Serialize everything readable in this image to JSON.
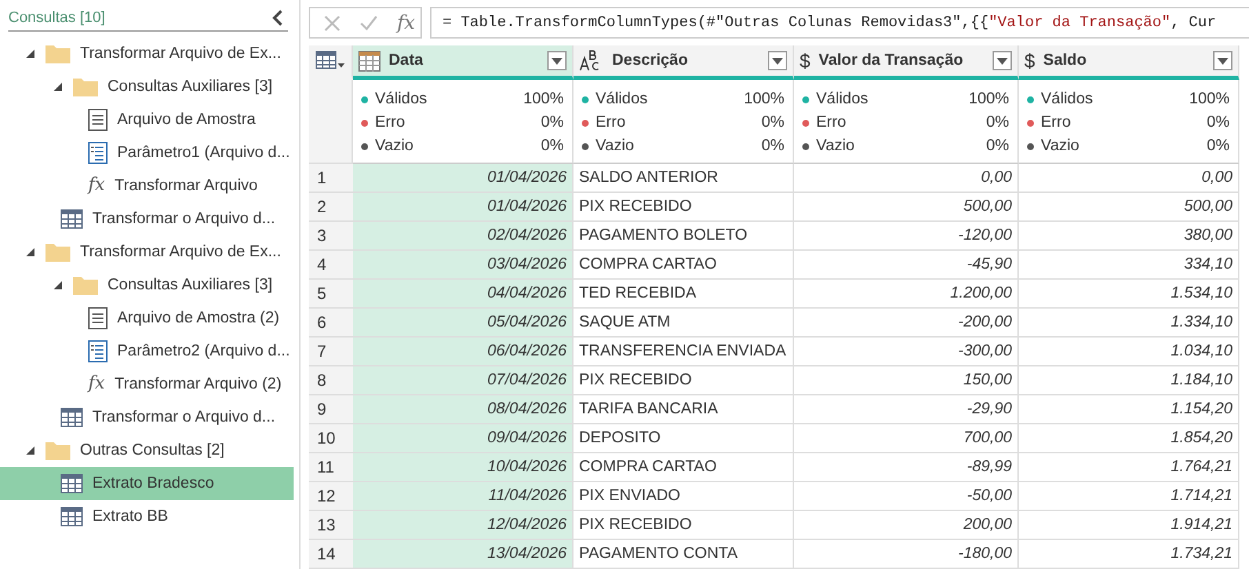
{
  "queries": {
    "title": "Consultas [10]",
    "items": [
      {
        "kind": "folder",
        "label": "Transformar Arquivo de Ex...",
        "expanded": true,
        "selected": false,
        "children": [
          {
            "kind": "folder",
            "label": "Consultas Auxiliares [3]",
            "expanded": true,
            "selected": false,
            "children": [
              {
                "kind": "query",
                "label": "Arquivo de Amostra",
                "selected": false
              },
              {
                "kind": "parameter",
                "label": "Parâmetro1 (Arquivo d...",
                "selected": false
              },
              {
                "kind": "function",
                "icon": "fx",
                "label": "Transformar Arquivo",
                "selected": false
              }
            ]
          },
          {
            "kind": "table",
            "label": "Transformar o Arquivo d...",
            "selected": false
          }
        ]
      },
      {
        "kind": "folder",
        "label": "Transformar Arquivo de Ex...",
        "expanded": true,
        "selected": false,
        "children": [
          {
            "kind": "folder",
            "label": "Consultas Auxiliares [3]",
            "expanded": true,
            "selected": false,
            "children": [
              {
                "kind": "query",
                "label": "Arquivo de Amostra (2)",
                "selected": false
              },
              {
                "kind": "parameter",
                "label": "Parâmetro2 (Arquivo d...",
                "selected": false
              },
              {
                "kind": "function",
                "icon": "fx",
                "label": "Transformar Arquivo (2)",
                "selected": false
              }
            ]
          },
          {
            "kind": "table",
            "label": "Transformar o Arquivo d...",
            "selected": false
          }
        ]
      },
      {
        "kind": "folder",
        "label": "Outras Consultas [2]",
        "expanded": true,
        "selected": false,
        "children": [
          {
            "kind": "table",
            "label": "Extrato Bradesco",
            "selected": true
          },
          {
            "kind": "table",
            "label": "Extrato BB",
            "selected": false
          }
        ]
      }
    ]
  },
  "formula_bar": {
    "fx": "fx",
    "segments": [
      {
        "kind": "code",
        "text": "= Table.TransformColumnTypes(#\"Outras Colunas Removidas3\",{{"
      },
      {
        "kind": "string",
        "text": "\"Valor da Transação\""
      },
      {
        "kind": "code",
        "text": ", Cur"
      }
    ]
  },
  "table": {
    "columns": [
      {
        "name": "Data",
        "kind": "date",
        "selected": true,
        "stats": [
          {
            "label": "Válidos",
            "value": "100%",
            "color": "#1fb3a3"
          },
          {
            "label": "Erro",
            "value": "0%",
            "color": "#e05a5a"
          },
          {
            "label": "Vazio",
            "value": "0%",
            "color": "#555555"
          }
        ]
      },
      {
        "name": "Descrição",
        "kind": "text",
        "selected": false,
        "stats": [
          {
            "label": "Válidos",
            "value": "100%",
            "color": "#1fb3a3"
          },
          {
            "label": "Erro",
            "value": "0%",
            "color": "#e05a5a"
          },
          {
            "label": "Vazio",
            "value": "0%",
            "color": "#555555"
          }
        ]
      },
      {
        "name": "Valor da Transação",
        "kind": "currency",
        "symbol": "$",
        "selected": false,
        "stats": [
          {
            "label": "Válidos",
            "value": "100%",
            "color": "#1fb3a3"
          },
          {
            "label": "Erro",
            "value": "0%",
            "color": "#e05a5a"
          },
          {
            "label": "Vazio",
            "value": "0%",
            "color": "#555555"
          }
        ]
      },
      {
        "name": "Saldo",
        "kind": "currency",
        "symbol": "$",
        "selected": false,
        "stats": [
          {
            "label": "Válidos",
            "value": "100%",
            "color": "#1fb3a3"
          },
          {
            "label": "Erro",
            "value": "0%",
            "color": "#e05a5a"
          },
          {
            "label": "Vazio",
            "value": "0%",
            "color": "#555555"
          }
        ]
      }
    ],
    "rows": [
      {
        "n": "1",
        "cells": [
          "01/04/2026",
          "SALDO ANTERIOR",
          "0,00",
          "0,00"
        ]
      },
      {
        "n": "2",
        "cells": [
          "01/04/2026",
          "PIX RECEBIDO",
          "500,00",
          "500,00"
        ]
      },
      {
        "n": "3",
        "cells": [
          "02/04/2026",
          "PAGAMENTO BOLETO",
          "-120,00",
          "380,00"
        ]
      },
      {
        "n": "4",
        "cells": [
          "03/04/2026",
          "COMPRA CARTAO",
          "-45,90",
          "334,10"
        ]
      },
      {
        "n": "5",
        "cells": [
          "04/04/2026",
          "TED RECEBIDA",
          "1.200,00",
          "1.534,10"
        ]
      },
      {
        "n": "6",
        "cells": [
          "05/04/2026",
          "SAQUE ATM",
          "-200,00",
          "1.334,10"
        ]
      },
      {
        "n": "7",
        "cells": [
          "06/04/2026",
          "TRANSFERENCIA ENVIADA",
          "-300,00",
          "1.034,10"
        ]
      },
      {
        "n": "8",
        "cells": [
          "07/04/2026",
          "PIX RECEBIDO",
          "150,00",
          "1.184,10"
        ]
      },
      {
        "n": "9",
        "cells": [
          "08/04/2026",
          "TARIFA BANCARIA",
          "-29,90",
          "1.154,20"
        ]
      },
      {
        "n": "10",
        "cells": [
          "09/04/2026",
          "DEPOSITO",
          "700,00",
          "1.854,20"
        ]
      },
      {
        "n": "11",
        "cells": [
          "10/04/2026",
          "COMPRA CARTAO",
          "-89,99",
          "1.764,21"
        ]
      },
      {
        "n": "12",
        "cells": [
          "11/04/2026",
          "PIX ENVIADO",
          "-50,00",
          "1.714,21"
        ]
      },
      {
        "n": "13",
        "cells": [
          "12/04/2026",
          "PIX RECEBIDO",
          "200,00",
          "1.914,21"
        ]
      },
      {
        "n": "14",
        "cells": [
          "13/04/2026",
          "PAGAMENTO CONTA",
          "-180,00",
          "1.734,21"
        ]
      }
    ]
  }
}
